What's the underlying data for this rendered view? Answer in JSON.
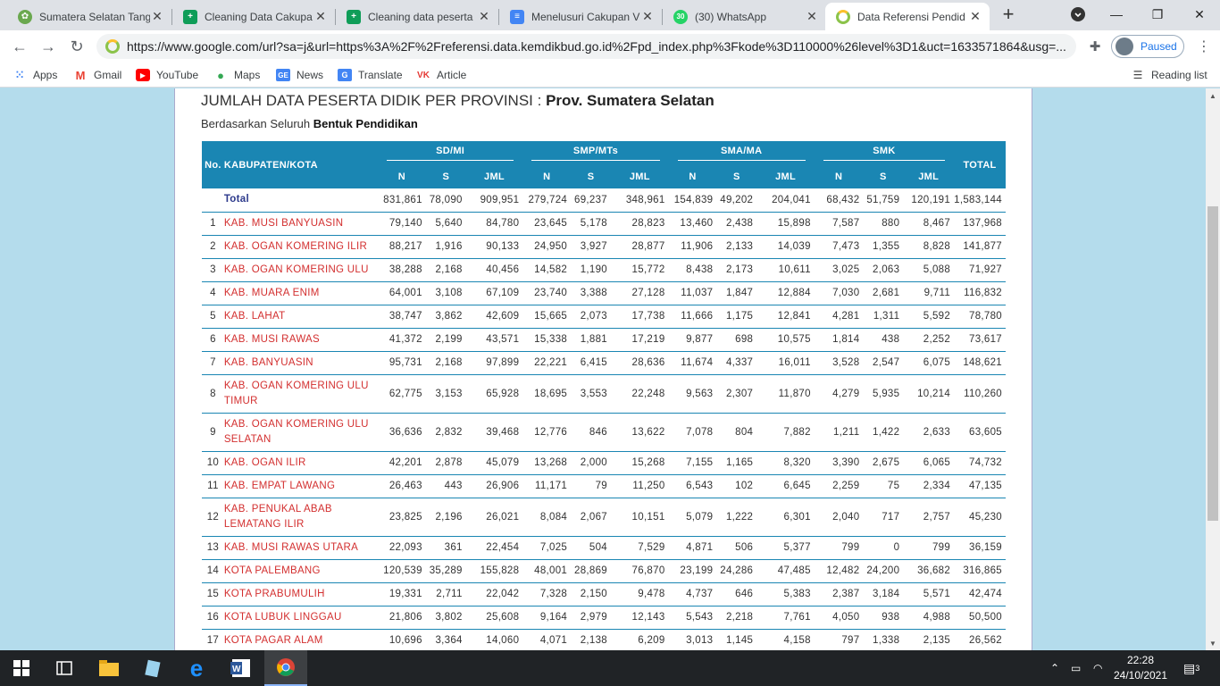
{
  "browser": {
    "tabs": [
      {
        "title": "Sumatera Selatan Tang",
        "icon": "leaf-icon",
        "active": false
      },
      {
        "title": "Cleaning Data Cakupa",
        "icon": "sheets-icon",
        "active": false
      },
      {
        "title": "Cleaning data peserta",
        "icon": "sheets-icon",
        "active": false
      },
      {
        "title": "Menelusuri Cakupan V",
        "icon": "docs-icon",
        "active": false
      },
      {
        "title": "(30) WhatsApp",
        "icon": "whatsapp-icon",
        "active": false
      },
      {
        "title": "Data Referensi Pendid",
        "icon": "kemdikbud-icon",
        "active": true
      }
    ],
    "url": "https://www.google.com/url?sa=j&url=https%3A%2F%2Freferensi.data.kemdikbud.go.id%2Fpd_index.php%3Fkode%3D110000%26level%3D1&uct=1633571864&usg=...",
    "profile_label": "Paused",
    "bookmarks": [
      {
        "label": "Apps"
      },
      {
        "label": "Gmail"
      },
      {
        "label": "YouTube"
      },
      {
        "label": "Maps"
      },
      {
        "label": "News"
      },
      {
        "label": "Translate"
      },
      {
        "label": "Article"
      }
    ],
    "reading_list": "Reading list"
  },
  "page": {
    "title_prefix": "JUMLAH DATA PESERTA DIDIK PER PROVINSI : ",
    "title_bold": "Prov. Sumatera Selatan",
    "subtitle_prefix": "Berdasarkan Seluruh ",
    "subtitle_bold": "Bentuk Pendidikan"
  },
  "table": {
    "headers": {
      "no": "No.",
      "region": "KABUPATEN/KOTA",
      "groups": [
        "SD/MI",
        "SMP/MTs",
        "SMA/MA",
        "SMK"
      ],
      "sub": [
        "N",
        "S",
        "JML"
      ],
      "total": "TOTAL"
    },
    "rows": [
      {
        "no": "",
        "name": "Total",
        "v": [
          "831,861",
          "78,090",
          "909,951",
          "279,724",
          "69,237",
          "348,961",
          "154,839",
          "49,202",
          "204,041",
          "68,432",
          "51,759",
          "120,191",
          "1,583,144"
        ]
      },
      {
        "no": "1",
        "name": "KAB. MUSI BANYUASIN",
        "v": [
          "79,140",
          "5,640",
          "84,780",
          "23,645",
          "5,178",
          "28,823",
          "13,460",
          "2,438",
          "15,898",
          "7,587",
          "880",
          "8,467",
          "137,968"
        ]
      },
      {
        "no": "2",
        "name": "KAB. OGAN KOMERING ILIR",
        "v": [
          "88,217",
          "1,916",
          "90,133",
          "24,950",
          "3,927",
          "28,877",
          "11,906",
          "2,133",
          "14,039",
          "7,473",
          "1,355",
          "8,828",
          "141,877"
        ]
      },
      {
        "no": "3",
        "name": "KAB. OGAN KOMERING ULU",
        "v": [
          "38,288",
          "2,168",
          "40,456",
          "14,582",
          "1,190",
          "15,772",
          "8,438",
          "2,173",
          "10,611",
          "3,025",
          "2,063",
          "5,088",
          "71,927"
        ]
      },
      {
        "no": "4",
        "name": "KAB. MUARA ENIM",
        "v": [
          "64,001",
          "3,108",
          "67,109",
          "23,740",
          "3,388",
          "27,128",
          "11,037",
          "1,847",
          "12,884",
          "7,030",
          "2,681",
          "9,711",
          "116,832"
        ]
      },
      {
        "no": "5",
        "name": "KAB. LAHAT",
        "v": [
          "38,747",
          "3,862",
          "42,609",
          "15,665",
          "2,073",
          "17,738",
          "11,666",
          "1,175",
          "12,841",
          "4,281",
          "1,311",
          "5,592",
          "78,780"
        ]
      },
      {
        "no": "6",
        "name": "KAB. MUSI RAWAS",
        "v": [
          "41,372",
          "2,199",
          "43,571",
          "15,338",
          "1,881",
          "17,219",
          "9,877",
          "698",
          "10,575",
          "1,814",
          "438",
          "2,252",
          "73,617"
        ]
      },
      {
        "no": "7",
        "name": "KAB. BANYUASIN",
        "v": [
          "95,731",
          "2,168",
          "97,899",
          "22,221",
          "6,415",
          "28,636",
          "11,674",
          "4,337",
          "16,011",
          "3,528",
          "2,547",
          "6,075",
          "148,621"
        ]
      },
      {
        "no": "8",
        "name": "KAB. OGAN KOMERING ULU TIMUR",
        "tall": true,
        "v": [
          "62,775",
          "3,153",
          "65,928",
          "18,695",
          "3,553",
          "22,248",
          "9,563",
          "2,307",
          "11,870",
          "4,279",
          "5,935",
          "10,214",
          "110,260"
        ]
      },
      {
        "no": "9",
        "name": "KAB. OGAN KOMERING ULU SELATAN",
        "tall": true,
        "v": [
          "36,636",
          "2,832",
          "39,468",
          "12,776",
          "846",
          "13,622",
          "7,078",
          "804",
          "7,882",
          "1,211",
          "1,422",
          "2,633",
          "63,605"
        ]
      },
      {
        "no": "10",
        "name": "KAB. OGAN ILIR",
        "v": [
          "42,201",
          "2,878",
          "45,079",
          "13,268",
          "2,000",
          "15,268",
          "7,155",
          "1,165",
          "8,320",
          "3,390",
          "2,675",
          "6,065",
          "74,732"
        ]
      },
      {
        "no": "11",
        "name": "KAB. EMPAT LAWANG",
        "v": [
          "26,463",
          "443",
          "26,906",
          "11,171",
          "79",
          "11,250",
          "6,543",
          "102",
          "6,645",
          "2,259",
          "75",
          "2,334",
          "47,135"
        ]
      },
      {
        "no": "12",
        "name": "KAB. PENUKAL ABAB LEMATANG ILIR",
        "tall": true,
        "v": [
          "23,825",
          "2,196",
          "26,021",
          "8,084",
          "2,067",
          "10,151",
          "5,079",
          "1,222",
          "6,301",
          "2,040",
          "717",
          "2,757",
          "45,230"
        ]
      },
      {
        "no": "13",
        "name": "KAB. MUSI RAWAS UTARA",
        "v": [
          "22,093",
          "361",
          "22,454",
          "7,025",
          "504",
          "7,529",
          "4,871",
          "506",
          "5,377",
          "799",
          "0",
          "799",
          "36,159"
        ]
      },
      {
        "no": "14",
        "name": "KOTA PALEMBANG",
        "v": [
          "120,539",
          "35,289",
          "155,828",
          "48,001",
          "28,869",
          "76,870",
          "23,199",
          "24,286",
          "47,485",
          "12,482",
          "24,200",
          "36,682",
          "316,865"
        ]
      },
      {
        "no": "15",
        "name": "KOTA PRABUMULIH",
        "v": [
          "19,331",
          "2,711",
          "22,042",
          "7,328",
          "2,150",
          "9,478",
          "4,737",
          "646",
          "5,383",
          "2,387",
          "3,184",
          "5,571",
          "42,474"
        ]
      },
      {
        "no": "16",
        "name": "KOTA LUBUK LINGGAU",
        "v": [
          "21,806",
          "3,802",
          "25,608",
          "9,164",
          "2,979",
          "12,143",
          "5,543",
          "2,218",
          "7,761",
          "4,050",
          "938",
          "4,988",
          "50,500"
        ]
      },
      {
        "no": "17",
        "name": "KOTA PAGAR ALAM",
        "v": [
          "10,696",
          "3,364",
          "14,060",
          "4,071",
          "2,138",
          "6,209",
          "3,013",
          "1,145",
          "4,158",
          "797",
          "1,338",
          "2,135",
          "26,562"
        ]
      }
    ]
  },
  "taskbar": {
    "time": "22:28",
    "date": "24/10/2021",
    "notifications": "3"
  }
}
